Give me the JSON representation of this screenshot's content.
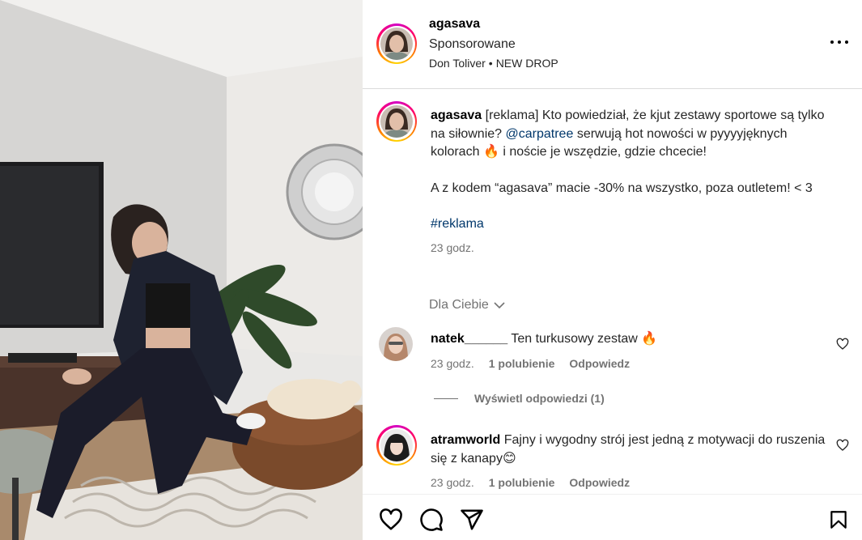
{
  "post": {
    "username": "agasava",
    "sponsored_label": "Sponsorowane",
    "audio_artist": "Don Toliver",
    "audio_separator": "•",
    "audio_track": "NEW DROP",
    "more_icon": "more-horizontal-icon"
  },
  "caption": {
    "username": "agasava",
    "text_1": "[reklama] Kto powiedział, że kjut zestawy sportowe są tylko na siłownie?",
    "mention": "@carpatree",
    "text_2": "serwują hot nowości w pyyyyjęknych kolorach",
    "emoji_1": "🔥",
    "text_3": "i noście je wszędzie, gdzie chcecie!",
    "paragraph_2": "A z kodem “agasava” macie -30% na wszystko, poza outletem! < 3",
    "hashtag": "#reklama",
    "time": "23 godz."
  },
  "for_you": {
    "label": "Dla Ciebie",
    "icon": "chevron-down-icon"
  },
  "comments": [
    {
      "username": "natek______",
      "text": "Ten turkusowy zestaw",
      "emoji": "🔥",
      "time": "23 godz.",
      "likes": "1 polubienie",
      "reply": "Odpowiedz",
      "view_replies": "Wyświetl odpowiedzi (1)"
    },
    {
      "username": "atramworld",
      "text": "Fajny i wygodny strój jest jedną z motywacji do ruszenia się z kanapy",
      "emoji": "😊",
      "time": "23 godz.",
      "likes": "1 polubienie",
      "reply": "Odpowiedz"
    }
  ],
  "actions": {
    "like_icon": "heart-icon",
    "comment_icon": "comment-icon",
    "share_icon": "share-icon",
    "save_icon": "bookmark-icon"
  },
  "colors": {
    "link": "#00376b",
    "secondary_text": "#737373",
    "divider": "#dbdbdb"
  }
}
